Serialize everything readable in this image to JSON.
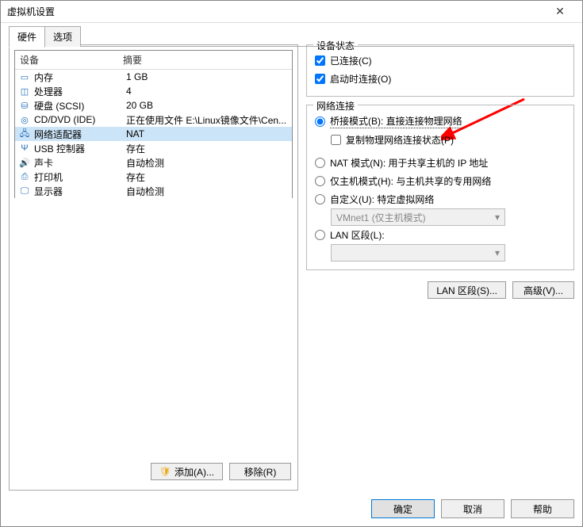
{
  "window": {
    "title": "虚拟机设置"
  },
  "tabs": {
    "hardware": "硬件",
    "options": "选项"
  },
  "device_table": {
    "header_device": "设备",
    "header_summary": "摘要",
    "rows": [
      {
        "icon": "memory-icon",
        "glyph": "▭",
        "name": "内存",
        "summary": "1 GB"
      },
      {
        "icon": "cpu-icon",
        "glyph": "◫",
        "name": "处理器",
        "summary": "4"
      },
      {
        "icon": "hdd-icon",
        "glyph": "⛁",
        "name": "硬盘 (SCSI)",
        "summary": "20 GB"
      },
      {
        "icon": "cd-icon",
        "glyph": "◎",
        "name": "CD/DVD (IDE)",
        "summary": "正在使用文件 E:\\Linux镜像文件\\Cen..."
      },
      {
        "icon": "network-icon",
        "glyph": "🖧",
        "name": "网络适配器",
        "summary": "NAT",
        "selected": true
      },
      {
        "icon": "usb-icon",
        "glyph": "Ψ",
        "name": "USB 控制器",
        "summary": "存在"
      },
      {
        "icon": "sound-icon",
        "glyph": "🔊",
        "name": "声卡",
        "summary": "自动检测"
      },
      {
        "icon": "printer-icon",
        "glyph": "⎙",
        "name": "打印机",
        "summary": "存在"
      },
      {
        "icon": "display-icon",
        "glyph": "🖵",
        "name": "显示器",
        "summary": "自动检测"
      }
    ]
  },
  "left_buttons": {
    "add": "添加(A)...",
    "remove": "移除(R)"
  },
  "device_status": {
    "legend": "设备状态",
    "connected": "已连接(C)",
    "connect_at_power_on": "启动时连接(O)"
  },
  "network": {
    "legend": "网络连接",
    "bridged_label": "桥接模式(B): 直接连接物理网络",
    "replicate_label": "复制物理网络连接状态(P)",
    "nat_label": "NAT 模式(N): 用于共享主机的 IP 地址",
    "hostonly_label": "仅主机模式(H): 与主机共享的专用网络",
    "custom_label": "自定义(U): 特定虚拟网络",
    "custom_combo": "VMnet1 (仅主机模式)",
    "lan_segment_label": "LAN 区段(L):",
    "lan_segment_combo": ""
  },
  "right_buttons": {
    "lan_segments": "LAN 区段(S)...",
    "advanced": "高级(V)..."
  },
  "footer": {
    "ok": "确定",
    "cancel": "取消",
    "help": "帮助"
  }
}
